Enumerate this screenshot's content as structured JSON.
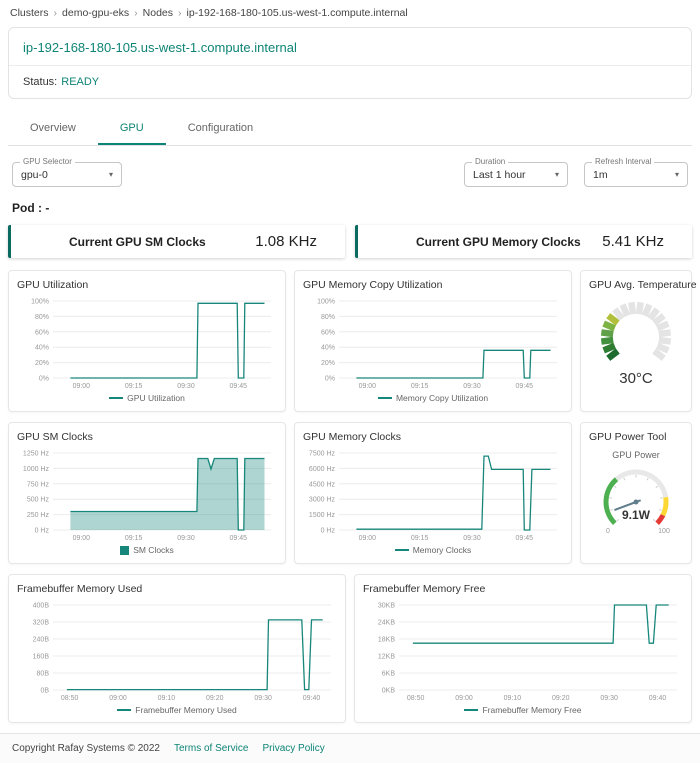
{
  "breadcrumb": {
    "separator": "›",
    "items": [
      "Clusters",
      "demo-gpu-eks",
      "Nodes",
      "ip-192-168-180-105.us-west-1.compute.internal"
    ]
  },
  "header": {
    "title": "ip-192-168-180-105.us-west-1.compute.internal",
    "status_label": "Status:",
    "status_value": "READY"
  },
  "tabs": [
    {
      "label": "Overview"
    },
    {
      "label": "GPU"
    },
    {
      "label": "Configuration"
    }
  ],
  "controls": {
    "gpu_selector": {
      "label": "GPU Selector",
      "value": "gpu-0"
    },
    "duration": {
      "label": "Duration",
      "value": "Last 1 hour"
    },
    "refresh_interval": {
      "label": "Refresh Interval",
      "value": "1m"
    }
  },
  "pod_label": "Pod : -",
  "stats": [
    {
      "label": "Current GPU SM Clocks",
      "value": "1.08 KHz"
    },
    {
      "label": "Current GPU Memory Clocks",
      "value": "5.41 KHz"
    }
  ],
  "colors": {
    "accent": "#0e8476",
    "chart_line": "#17877b",
    "stat_border": "#0b6b60"
  },
  "chart_data": [
    {
      "id": "gpu-utilization",
      "type": "line",
      "title": "GPU Utilization",
      "legend": "GPU Utilization",
      "color": "#17877b",
      "y_max": 100,
      "y_ticks": [
        {
          "v": 0,
          "label": "0%"
        },
        {
          "v": 20,
          "label": "20%"
        },
        {
          "v": 40,
          "label": "40%"
        },
        {
          "v": 60,
          "label": "60%"
        },
        {
          "v": 80,
          "label": "80%"
        },
        {
          "v": 100,
          "label": "100%"
        }
      ],
      "x_ticks": [
        {
          "p": 0.13,
          "label": "09:00"
        },
        {
          "p": 0.37,
          "label": "09:15"
        },
        {
          "p": 0.61,
          "label": "09:30"
        },
        {
          "p": 0.85,
          "label": "09:45"
        }
      ],
      "series": [
        {
          "name": "GPU Utilization",
          "points": [
            [
              0.08,
              0
            ],
            [
              0.66,
              0
            ],
            [
              0.665,
              97
            ],
            [
              0.845,
              97
            ],
            [
              0.85,
              0
            ],
            [
              0.875,
              0
            ],
            [
              0.88,
              97
            ],
            [
              0.97,
              97
            ]
          ]
        }
      ]
    },
    {
      "id": "gpu-memory-copy-utilization",
      "type": "line",
      "title": "GPU Memory Copy Utilization",
      "legend": "Memory Copy Utilization",
      "color": "#17877b",
      "y_max": 100,
      "y_ticks": [
        {
          "v": 0,
          "label": "0%"
        },
        {
          "v": 20,
          "label": "20%"
        },
        {
          "v": 40,
          "label": "40%"
        },
        {
          "v": 60,
          "label": "60%"
        },
        {
          "v": 80,
          "label": "80%"
        },
        {
          "v": 100,
          "label": "100%"
        }
      ],
      "x_ticks": [
        {
          "p": 0.13,
          "label": "09:00"
        },
        {
          "p": 0.37,
          "label": "09:15"
        },
        {
          "p": 0.61,
          "label": "09:30"
        },
        {
          "p": 0.85,
          "label": "09:45"
        }
      ],
      "series": [
        {
          "name": "Memory Copy Utilization",
          "points": [
            [
              0.08,
              0
            ],
            [
              0.66,
              0
            ],
            [
              0.665,
              36
            ],
            [
              0.845,
              36
            ],
            [
              0.85,
              0
            ],
            [
              0.875,
              0
            ],
            [
              0.88,
              36
            ],
            [
              0.97,
              36
            ]
          ]
        }
      ]
    },
    {
      "id": "gpu-sm-clocks",
      "type": "area",
      "title": "GPU SM Clocks",
      "legend": "SM Clocks",
      "color": "#17877b",
      "y_max": 1250,
      "y_ticks": [
        {
          "v": 0,
          "label": "0 Hz"
        },
        {
          "v": 250,
          "label": "250 Hz"
        },
        {
          "v": 500,
          "label": "500 Hz"
        },
        {
          "v": 750,
          "label": "750 Hz"
        },
        {
          "v": 1000,
          "label": "1000 Hz"
        },
        {
          "v": 1250,
          "label": "1250 Hz"
        }
      ],
      "x_ticks": [
        {
          "p": 0.13,
          "label": "09:00"
        },
        {
          "p": 0.37,
          "label": "09:15"
        },
        {
          "p": 0.61,
          "label": "09:30"
        },
        {
          "p": 0.85,
          "label": "09:45"
        }
      ],
      "series": [
        {
          "name": "SM Clocks",
          "points": [
            [
              0.08,
              300
            ],
            [
              0.66,
              300
            ],
            [
              0.665,
              1160
            ],
            [
              0.71,
              1160
            ],
            [
              0.725,
              990
            ],
            [
              0.74,
              1160
            ],
            [
              0.845,
              1160
            ],
            [
              0.85,
              0
            ],
            [
              0.875,
              0
            ],
            [
              0.88,
              1160
            ],
            [
              0.97,
              1160
            ]
          ]
        }
      ]
    },
    {
      "id": "gpu-memory-clocks",
      "type": "line",
      "title": "GPU Memory Clocks",
      "legend": "Memory Clocks",
      "color": "#17877b",
      "y_max": 7500,
      "y_ticks": [
        {
          "v": 0,
          "label": "0 Hz"
        },
        {
          "v": 1500,
          "label": "1500 Hz"
        },
        {
          "v": 3000,
          "label": "3000 Hz"
        },
        {
          "v": 4500,
          "label": "4500 Hz"
        },
        {
          "v": 6000,
          "label": "6000 Hz"
        },
        {
          "v": 7500,
          "label": "7500 Hz"
        }
      ],
      "x_ticks": [
        {
          "p": 0.13,
          "label": "09:00"
        },
        {
          "p": 0.37,
          "label": "09:15"
        },
        {
          "p": 0.61,
          "label": "09:30"
        },
        {
          "p": 0.85,
          "label": "09:45"
        }
      ],
      "series": [
        {
          "name": "Memory Clocks",
          "points": [
            [
              0.08,
              80
            ],
            [
              0.655,
              80
            ],
            [
              0.665,
              7200
            ],
            [
              0.685,
              7200
            ],
            [
              0.7,
              5900
            ],
            [
              0.845,
              5900
            ],
            [
              0.85,
              0
            ],
            [
              0.875,
              0
            ],
            [
              0.885,
              5900
            ],
            [
              0.97,
              5900
            ]
          ]
        }
      ]
    },
    {
      "id": "framebuffer-memory-used",
      "type": "line",
      "title": "Framebuffer Memory Used",
      "legend": "Framebuffer Memory Used",
      "color": "#17877b",
      "y_max": 400,
      "y_ticks": [
        {
          "v": 0,
          "label": "0B"
        },
        {
          "v": 80,
          "label": "80B"
        },
        {
          "v": 160,
          "label": "160B"
        },
        {
          "v": 240,
          "label": "240B"
        },
        {
          "v": 320,
          "label": "320B"
        },
        {
          "v": 400,
          "label": "400B"
        }
      ],
      "x_ticks": [
        {
          "p": 0.06,
          "label": "08:50"
        },
        {
          "p": 0.234,
          "label": "09:00"
        },
        {
          "p": 0.408,
          "label": "09:10"
        },
        {
          "p": 0.582,
          "label": "09:20"
        },
        {
          "p": 0.756,
          "label": "09:30"
        },
        {
          "p": 0.93,
          "label": "09:40"
        }
      ],
      "series": [
        {
          "name": "Framebuffer Memory Used",
          "points": [
            [
              0.05,
              2
            ],
            [
              0.77,
              2
            ],
            [
              0.775,
              330
            ],
            [
              0.895,
              330
            ],
            [
              0.905,
              2
            ],
            [
              0.92,
              2
            ],
            [
              0.93,
              330
            ],
            [
              0.97,
              330
            ]
          ]
        }
      ]
    },
    {
      "id": "framebuffer-memory-free",
      "type": "line",
      "title": "Framebuffer Memory Free",
      "legend": "Framebuffer Memory Free",
      "color": "#17877b",
      "y_max": 30,
      "y_ticks": [
        {
          "v": 0,
          "label": "0KB"
        },
        {
          "v": 6,
          "label": "6KB"
        },
        {
          "v": 12,
          "label": "12KB"
        },
        {
          "v": 18,
          "label": "18KB"
        },
        {
          "v": 24,
          "label": "24KB"
        },
        {
          "v": 30,
          "label": "30KB"
        }
      ],
      "x_ticks": [
        {
          "p": 0.06,
          "label": "08:50"
        },
        {
          "p": 0.234,
          "label": "09:00"
        },
        {
          "p": 0.408,
          "label": "09:10"
        },
        {
          "p": 0.582,
          "label": "09:20"
        },
        {
          "p": 0.756,
          "label": "09:30"
        },
        {
          "p": 0.93,
          "label": "09:40"
        }
      ],
      "series": [
        {
          "name": "Framebuffer Memory Free",
          "points": [
            [
              0.05,
              16.5
            ],
            [
              0.77,
              16.5
            ],
            [
              0.775,
              30
            ],
            [
              0.89,
              30
            ],
            [
              0.9,
              16.5
            ],
            [
              0.915,
              16.5
            ],
            [
              0.925,
              30
            ],
            [
              0.97,
              30
            ]
          ]
        }
      ]
    }
  ],
  "gauges": {
    "temperature": {
      "title": "GPU Avg. Temperature",
      "value": 30,
      "max": 100,
      "display": "30°C",
      "segments": 18,
      "active_fraction": 0.33,
      "active_colors": [
        "#1e6b2f",
        "#2e7d32",
        "#43913f",
        "#5fa049",
        "#7cb342",
        "#b2bf3b"
      ],
      "inactive_color": "#e4e4e4"
    },
    "power": {
      "title": "GPU Power Tool",
      "label": "GPU Power",
      "value": 9.1,
      "max": 100,
      "display": "9.1W",
      "min_label": "0",
      "max_label": "100",
      "needle_color": "#607d8b",
      "zones": [
        {
          "to": 0.35,
          "color": "#4caf50"
        },
        {
          "to": 0.8,
          "color": "#e8e8e8"
        },
        {
          "to": 0.93,
          "color": "#fdd835"
        },
        {
          "to": 1,
          "color": "#e53935"
        }
      ]
    }
  },
  "footer": {
    "copyright": "Copyright Rafay Systems © 2022",
    "links": [
      {
        "label": "Terms of Service"
      },
      {
        "label": "Privacy Policy"
      }
    ]
  }
}
